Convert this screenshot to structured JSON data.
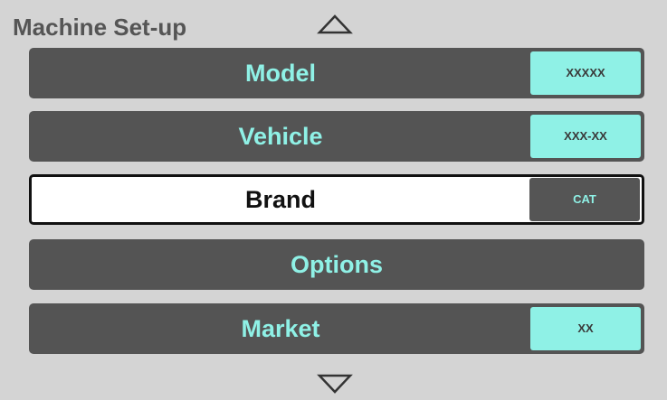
{
  "header": {
    "title": "Machine Set-up",
    "scroll_up_icon": "triangle-up-outline-icon",
    "scroll_down_icon": "triangle-down-outline-icon"
  },
  "colors": {
    "background": "#d4d4d4",
    "row_background": "#545454",
    "accent": "#8ff1e6",
    "selected_background": "#ffffff",
    "title_text": "#555555"
  },
  "menu": {
    "selected_index": 2,
    "items": [
      {
        "label": "Model",
        "value": "XXXXX"
      },
      {
        "label": "Vehicle",
        "value": "XXX-XX"
      },
      {
        "label": "Brand",
        "value": "CAT"
      },
      {
        "label": "Options",
        "value": ""
      },
      {
        "label": "Market",
        "value": "XX"
      }
    ]
  }
}
